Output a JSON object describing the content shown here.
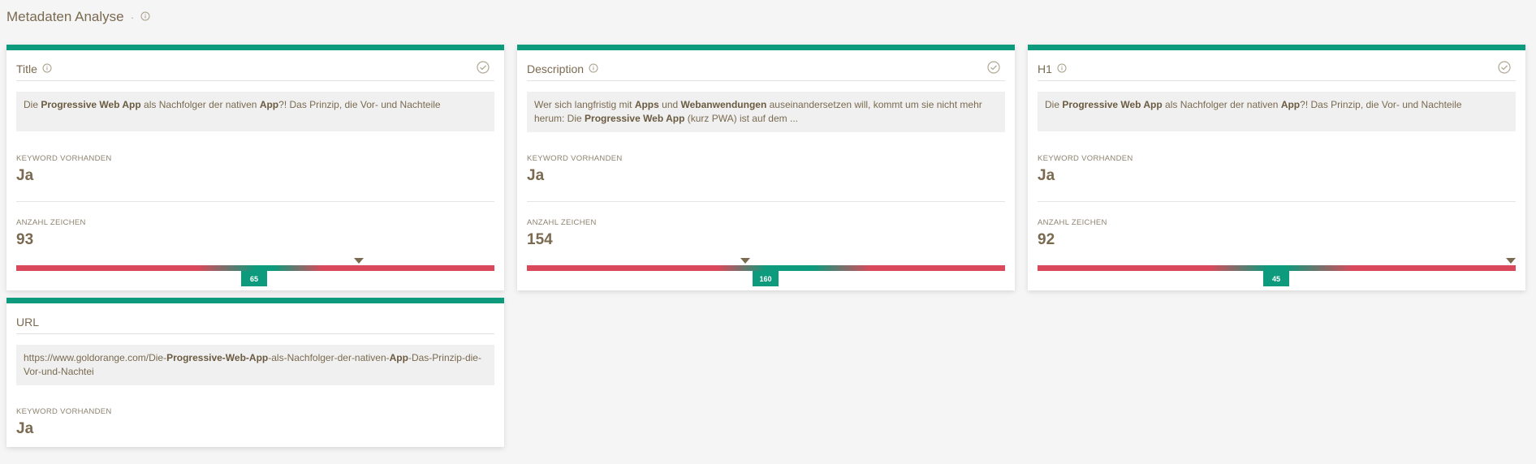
{
  "page": {
    "title": "Metadaten Analyse",
    "separator": "·"
  },
  "colors": {
    "accent": "#0e9a7c",
    "bad": "#d9495b",
    "text": "#7a6a50"
  },
  "cards": {
    "title": {
      "heading": "Title",
      "snippet_parts": [
        {
          "t": "Die ",
          "b": false
        },
        {
          "t": "Progressive Web App",
          "b": true
        },
        {
          "t": " als Nachfolger der nativen ",
          "b": false
        },
        {
          "t": "App",
          "b": true
        },
        {
          "t": "?! Das Prinzip, die Vor- und Nachteile",
          "b": false
        }
      ],
      "keyword_label": "KEYWORD VORHANDEN",
      "keyword_value": "Ja",
      "count_label": "ANZAHL ZEICHEN",
      "count_value": "93",
      "ideal_label": "65"
    },
    "description": {
      "heading": "Description",
      "snippet_parts": [
        {
          "t": "Wer sich langfristig mit ",
          "b": false
        },
        {
          "t": "Apps",
          "b": true
        },
        {
          "t": " und ",
          "b": false
        },
        {
          "t": "Webanwendungen",
          "b": true
        },
        {
          "t": " auseinandersetzen will, kommt um sie nicht mehr herum: Die ",
          "b": false
        },
        {
          "t": "Progressive Web App",
          "b": true
        },
        {
          "t": " (kurz PWA) ist auf dem ...",
          "b": false
        }
      ],
      "keyword_label": "KEYWORD VORHANDEN",
      "keyword_value": "Ja",
      "count_label": "ANZAHL ZEICHEN",
      "count_value": "154",
      "ideal_label": "160"
    },
    "h1": {
      "heading": "H1",
      "snippet_parts": [
        {
          "t": "Die ",
          "b": false
        },
        {
          "t": "Progressive Web App",
          "b": true
        },
        {
          "t": " als Nachfolger der nativen ",
          "b": false
        },
        {
          "t": "App",
          "b": true
        },
        {
          "t": "?! Das Prinzip, die Vor- und Nachteile",
          "b": false
        }
      ],
      "keyword_label": "KEYWORD VORHANDEN",
      "keyword_value": "Ja",
      "count_label": "ANZAHL ZEICHEN",
      "count_value": "92",
      "ideal_label": "45"
    },
    "url": {
      "heading": "URL",
      "snippet_parts": [
        {
          "t": "https://www.goldorange.com/Die-",
          "b": false
        },
        {
          "t": "Progressive-Web-App",
          "b": true
        },
        {
          "t": "-als-Nachfolger-der-nativen-",
          "b": false
        },
        {
          "t": "App",
          "b": true
        },
        {
          "t": "-Das-Prinzip-die-Vor-und-Nachtei",
          "b": false
        }
      ],
      "keyword_label": "KEYWORD VORHANDEN",
      "keyword_value": "Ja"
    }
  }
}
